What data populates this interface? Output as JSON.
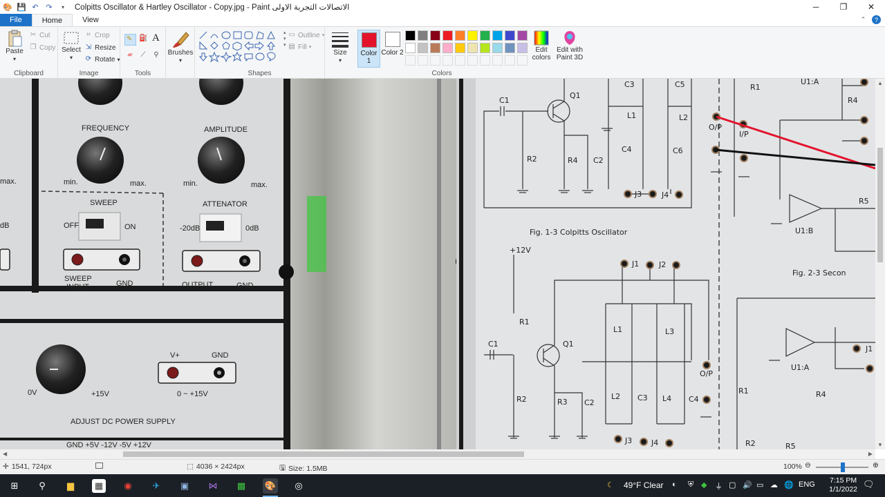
{
  "window": {
    "title": "الاتصالات التجربة الاولى Colpitts Oscillator & Hartley Oscillator - Copy.jpg - Paint",
    "minimize": "─",
    "maximize": "❐",
    "close": "✕"
  },
  "tabs": [
    {
      "label": "File"
    },
    {
      "label": "Home"
    },
    {
      "label": "View"
    }
  ],
  "ribbon": {
    "clipboard": {
      "label": "Clipboard",
      "paste": "Paste",
      "cut": "Cut",
      "copy": "Copy"
    },
    "image": {
      "label": "Image",
      "select": "Select",
      "crop": "Crop",
      "resize": "Resize",
      "rotate": "Rotate"
    },
    "tools": {
      "label": "Tools"
    },
    "brushes": {
      "label": "Brushes"
    },
    "shapes": {
      "label": "Shapes",
      "outline": "Outline",
      "fill": "Fill"
    },
    "size": {
      "label": "Size"
    },
    "colors": {
      "label": "Colors",
      "color1": "Color 1",
      "color2": "Color 2",
      "color1_value": "#e3132b",
      "color2_value": "#ffffff",
      "edit_colors": "Edit colors",
      "edit_paint3d": "Edit with Paint 3D",
      "palette_row1": [
        "#000000",
        "#7f7f7f",
        "#880015",
        "#ed1c24",
        "#ff7f27",
        "#fff200",
        "#22b14c",
        "#00a2e8",
        "#3f48cc",
        "#a349a4"
      ],
      "palette_row2": [
        "#ffffff",
        "#c3c3c3",
        "#b97a57",
        "#ffaec9",
        "#ffc90e",
        "#efe4b0",
        "#b5e61d",
        "#99d9ea",
        "#7092be",
        "#c8bfe7"
      ]
    }
  },
  "panel": {
    "frequency": "FREQUENCY",
    "amplitude": "AMPLITUDE",
    "min": "min.",
    "max": "max.",
    "max_left": "max.",
    "sweep": "SWEEP",
    "off": "OFF",
    "on": "ON",
    "attenator": "ATTENATOR",
    "minus20db": "-20dB",
    "zerodb": "0dB",
    "db_left": "dB",
    "sweep_input": "SWEEP\nINPUT",
    "gnd": "GND",
    "output": "OUTPUT",
    "vplus": "V+",
    "zero_v": "0V",
    "plus15v": "+15V",
    "range": "0 ~ +15V",
    "adjust": "ADJUST DC POWER SUPPLY",
    "bottom_labels": "GND   +5V   -12V   -5V   +12V"
  },
  "circuit": {
    "fig13": "Fig. 1-3  Colpitts Oscillator",
    "fig23": "Fig. 2-3  Secon",
    "labels_top": [
      "C1",
      "Q1",
      "C3",
      "C5",
      "R1",
      "U1:A",
      "R4",
      "L1",
      "L2",
      "O/P",
      "I/P",
      "R2",
      "R4",
      "C2",
      "C4",
      "C6",
      "J3",
      "J4",
      "R5",
      "U1:B"
    ],
    "labels_bottom": [
      "+12V",
      "J1",
      "J2",
      "R1",
      "L1",
      "L3",
      "C1",
      "Q1",
      "O/P",
      "R2",
      "R3",
      "C2",
      "L2",
      "C3",
      "L4",
      "C4",
      "J3",
      "J4",
      "U1:A",
      "J1",
      "R1",
      "R4",
      "R2",
      "R5"
    ]
  },
  "status": {
    "cursor": "1541, 724px",
    "dimensions": "4036 × 2424px",
    "size": "Size: 1.5MB",
    "zoom": "100%"
  },
  "taskbar": {
    "weather": "49°F  Clear",
    "lang": "ENG",
    "time": "7:15 PM",
    "date": "1/1/2022"
  }
}
